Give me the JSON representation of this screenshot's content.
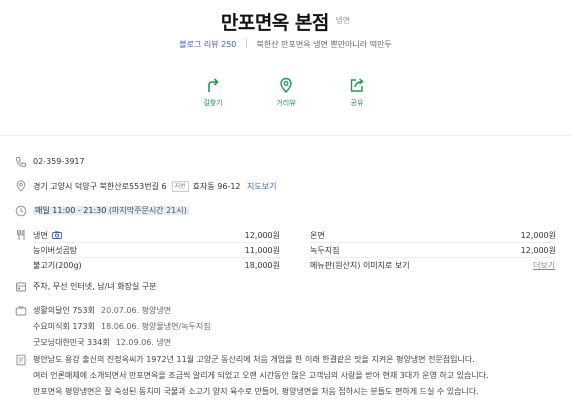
{
  "header": {
    "name": "만포면옥 본점",
    "category": "냉면",
    "blog_review_label": "블로그 리뷰",
    "blog_review_count": "250",
    "description": "북한산 만포면옥 냉면 뿐만아니라 떡만두"
  },
  "actions": [
    {
      "label": "길찾기",
      "icon": "route-icon"
    },
    {
      "label": "거리뷰",
      "icon": "location-pin-icon"
    },
    {
      "label": "공유",
      "icon": "share-icon"
    }
  ],
  "info": {
    "phone": "02-359-3917",
    "address": "경기 고양시 덕양구 북한산로553번길 6",
    "address_tag": "지번",
    "jibun": "효자동 96-12",
    "map_link": "지도보기",
    "hours": "매일 11:00 - 21:30",
    "last_order": "(마지막주문시간 21시)"
  },
  "menu": {
    "items": [
      {
        "name": "냉면",
        "price": "12,000원"
      },
      {
        "name": "온면",
        "price": "12,000원"
      },
      {
        "name": "능이버섯곰탕",
        "price": "11,000원"
      },
      {
        "name": "녹두지짐",
        "price": "12,000원"
      },
      {
        "name": "불고기(200g)",
        "price": "18,000원"
      }
    ],
    "photo_menu_link": "메뉴판(원산지) 이미지로 보기",
    "more": "더보기"
  },
  "facilities": "주차, 무선 인터넷, 남/녀 화장실 구분",
  "media": [
    {
      "program": "생활의달인 753회",
      "detail": "20.07.06. 평양냉면"
    },
    {
      "program": "수요미식회 173회",
      "detail": "18.06.06. 평양물냉면/녹두지짐"
    },
    {
      "program": "굿모닝대한민국 334회",
      "detail": "12.09.06. 냉면"
    }
  ],
  "intro": [
    "평안남도 용강 출신의 진정옥씨가 1972년 11월 고양군 동산리에 처음 개업을 한 이래 한결같은 맛을 지켜온 평양냉면 전문점입니다.",
    "여러 언론매체에 소개되면서 만포면옥을 조금씩 알리게 되었고 오랜 시간동안 많은 고객님의 사랑을 받아 현재 3대가 운영 하고 있습니다.",
    "만포면옥 평양냉면은 잘 숙성된 동치미 국물과 소고기 양지 육수로 만들어, 평양냉면을 처음 접하시는 분들도 편하게 드실 수 있습니다."
  ],
  "colors": {
    "accent_green": "#1a9a51",
    "link_blue": "#3b5bdb",
    "hours_highlight": "#e6ecf7"
  }
}
